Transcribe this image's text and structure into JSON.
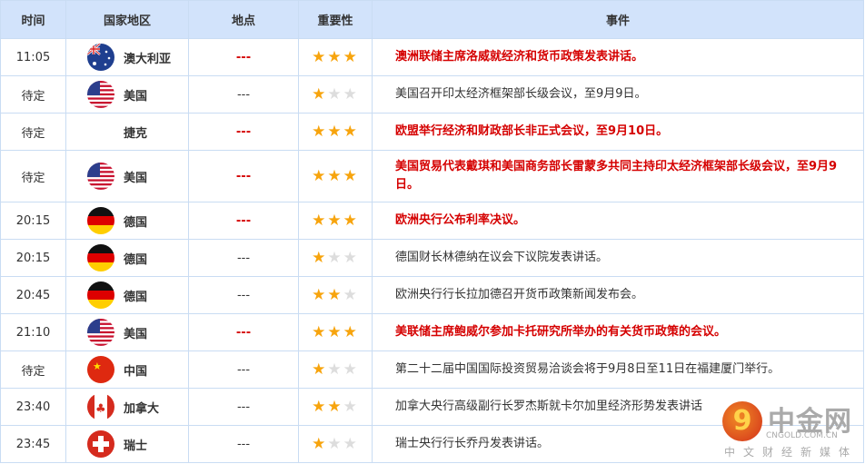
{
  "headers": [
    "时间",
    "国家地区",
    "地点",
    "重要性",
    "事件"
  ],
  "rows": [
    {
      "time": "11:05",
      "country": "澳大利亚",
      "flag": "australia",
      "location": "---",
      "stars": 3,
      "event": "澳洲联储主席洛威就经济和货币政策发表讲话。",
      "highlight": true
    },
    {
      "time": "待定",
      "country": "美国",
      "flag": "usa",
      "location": "---",
      "stars": 1,
      "event": "美国召开印太经济框架部长级会议，至9月9日。",
      "highlight": false
    },
    {
      "time": "待定",
      "country": "捷克",
      "flag": "none",
      "location": "---",
      "stars": 3,
      "event": "欧盟举行经济和财政部长非正式会议，至9月10日。",
      "highlight": true
    },
    {
      "time": "待定",
      "country": "美国",
      "flag": "usa",
      "location": "---",
      "stars": 3,
      "event": "美国贸易代表戴琪和美国商务部长雷蒙多共同主持印太经济框架部长级会议，至9月9日。",
      "highlight": true
    },
    {
      "time": "20:15",
      "country": "德国",
      "flag": "germany",
      "location": "---",
      "stars": 3,
      "event": "欧洲央行公布利率决议。",
      "highlight": true
    },
    {
      "time": "20:15",
      "country": "德国",
      "flag": "germany",
      "location": "---",
      "stars": 1,
      "event": "德国财长林德纳在议会下议院发表讲话。",
      "highlight": false
    },
    {
      "time": "20:45",
      "country": "德国",
      "flag": "germany",
      "location": "---",
      "stars": 2,
      "event": "欧洲央行行长拉加德召开货币政策新闻发布会。",
      "highlight": false
    },
    {
      "time": "21:10",
      "country": "美国",
      "flag": "usa",
      "location": "---",
      "stars": 3,
      "event": "美联储主席鲍威尔参加卡托研究所举办的有关货币政策的会议。",
      "highlight": true
    },
    {
      "time": "待定",
      "country": "中国",
      "flag": "china",
      "location": "---",
      "stars": 1,
      "event": "第二十二届中国国际投资贸易洽谈会将于9月8日至11日在福建厦门举行。",
      "highlight": false
    },
    {
      "time": "23:40",
      "country": "加拿大",
      "flag": "canada",
      "location": "---",
      "stars": 2,
      "event": "加拿大央行高级副行长罗杰斯就卡尔加里经济形势发表讲话",
      "highlight": false
    },
    {
      "time": "23:45",
      "country": "瑞士",
      "flag": "switzerland",
      "location": "---",
      "stars": 1,
      "event": "瑞士央行行长乔丹发表讲话。",
      "highlight": false
    }
  ],
  "watermark": {
    "name": "中金网",
    "url": "CNGOLD.COM.CN",
    "tagline": "中文财经新媒体"
  },
  "colors": {
    "header_bg": "#d2e3fb",
    "highlight": "#d50000",
    "star": "#f7a40d"
  }
}
